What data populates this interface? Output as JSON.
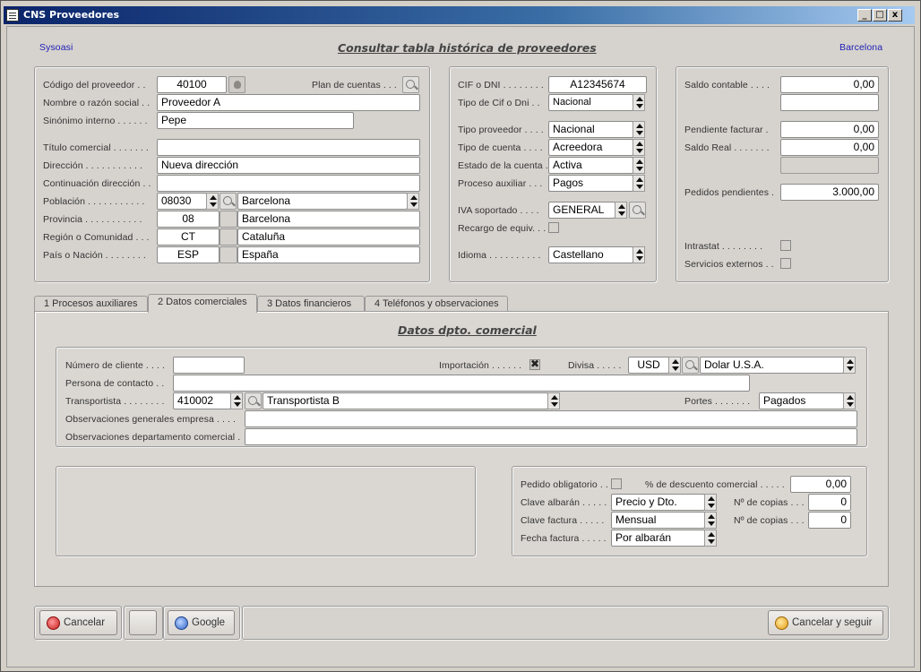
{
  "window": {
    "title": "CNS Proveedores",
    "min": "_",
    "max": "□",
    "close": "x"
  },
  "header": {
    "left": "Sysoasi",
    "center": "Consultar tabla histórica de proveedores",
    "right": "Barcelona"
  },
  "left_panel": {
    "codigo_label": "Código del proveedor . .",
    "codigo_value": "40100",
    "plan_label": "Plan de cuentas . . .",
    "nombre_label": "Nombre o razón social . .",
    "nombre_value": "Proveedor A",
    "sinonimo_label": "Sinónimo interno . . . . . .",
    "sinonimo_value": "Pepe",
    "titulo_label": "Título comercial . . . . . . .",
    "titulo_value": "",
    "direccion_label": "Dirección . . . . . . . . . . .",
    "direccion_value": "Nueva dirección",
    "continuacion_label": "Continuación dirección . .",
    "continuacion_value": "",
    "poblacion_label": "Población . . . . . . . . . . .",
    "poblacion_code": "08030",
    "poblacion_name": "Barcelona",
    "provincia_label": "Provincia . . . . . . . . . . .",
    "provincia_code": "08",
    "provincia_name": "Barcelona",
    "region_label": "Región o Comunidad . . .",
    "region_code": "CT",
    "region_name": "Cataluña",
    "pais_label": "País o Nación . . . . . . . .",
    "pais_code": "ESP",
    "pais_name": "España"
  },
  "mid_panel": {
    "cif_label": "CIF o DNI . . . . . . . .",
    "cif_value": "A12345674",
    "tipocif_label": "Tipo de Cif o Dni . .",
    "tipocif_value": "Nacional",
    "tipoprov_label": "Tipo proveedor . . . .",
    "tipoprov_value": "Nacional",
    "tipocta_label": "Tipo de cuenta . . . .",
    "tipocta_value": "Acreedora",
    "estado_label": "Estado de la cuenta .",
    "estado_value": "Activa",
    "proceso_label": "Proceso auxiliar . . .",
    "proceso_value": "Pagos",
    "iva_label": "IVA soportado . . . .",
    "iva_value": "GENERAL",
    "recargo_label": "Recargo de equiv. . .",
    "idioma_label": "Idioma . . . . . . . . . .",
    "idioma_value": "Castellano"
  },
  "right_panel": {
    "saldo_label": "Saldo contable . . . .",
    "saldo_value": "0,00",
    "pend_label": "Pendiente facturar .",
    "pend_value": "0,00",
    "real_label": "Saldo Real . . . . . . .",
    "real_value": "0,00",
    "pedidos_label": "Pedidos pendientes .",
    "pedidos_value": "3.000,00",
    "intrastat_label": "Intrastat . . . . . . . .",
    "servicios_label": "Servicios externos . ."
  },
  "tabs": [
    {
      "label": "1  Procesos auxiliares"
    },
    {
      "label": "2  Datos comerciales"
    },
    {
      "label": "3  Datos financieros"
    },
    {
      "label": "4  Teléfonos y observaciones"
    }
  ],
  "comercial": {
    "title": "Datos dpto. comercial",
    "numcli_label": "Número de cliente . . . .",
    "numcli_value": "",
    "importacion_label": "Importación . . . . . .",
    "divisa_label": "Divisa . . . . .",
    "divisa_code": "USD",
    "divisa_name": "Dolar U.S.A.",
    "persona_label": "Persona de contacto . .",
    "persona_value": "",
    "transportista_label": "Transportista . . . . . . . .",
    "transportista_code": "410002",
    "transportista_name": "Transportista B",
    "portes_label": "Portes . . . . . . .",
    "portes_value": "Pagados",
    "obsgen_label": "Observaciones generales empresa . . . .",
    "obsgen_value": "",
    "obsdep_label": "Observaciones departamento comercial .",
    "obsdep_value": "",
    "pedido_label": "Pedido obligatorio . .",
    "descuento_label": "% de descuento comercial . . . . .",
    "descuento_value": "0,00",
    "albaran_label": "Clave albarán . . . . .",
    "albaran_value": "Precio y Dto.",
    "copias1_label": "Nº de copias . . .",
    "copias1_value": "0",
    "factura_label": "Clave factura . . . . .",
    "factura_value": "Mensual",
    "copias2_label": "Nº de copias . . .",
    "copias2_value": "0",
    "fecha_label": "Fecha factura . . . . .",
    "fecha_value": "Por albarán"
  },
  "footer": {
    "cancelar": "Cancelar",
    "google": "Google",
    "cancelar_seguir": "Cancelar y seguir"
  },
  "colors": {
    "title_start": "#0a246a",
    "title_end": "#a6caf0",
    "header_text": "#1d1db5",
    "window_bg": "#d6d3ce"
  }
}
